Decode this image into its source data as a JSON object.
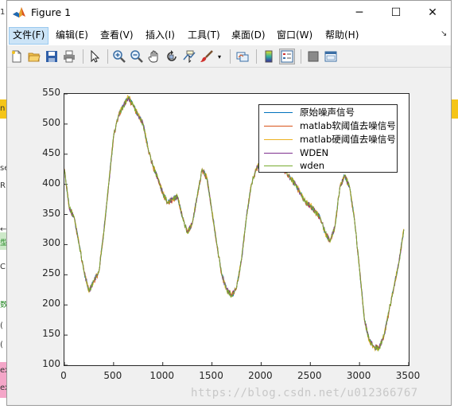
{
  "window": {
    "title": "Figure 1",
    "controls": {
      "minimize": "─",
      "maximize": "☐",
      "close": "✕"
    }
  },
  "menu": [
    {
      "label": "文件(F)",
      "active": true
    },
    {
      "label": "编辑(E)"
    },
    {
      "label": "查看(V)"
    },
    {
      "label": "插入(I)"
    },
    {
      "label": "工具(T)"
    },
    {
      "label": "桌面(D)"
    },
    {
      "label": "窗口(W)"
    },
    {
      "label": "帮助(H)"
    }
  ],
  "menu_overflow": "↘",
  "toolbar": [
    "new-figure-icon",
    "open-file-icon",
    "save-icon",
    "print-icon",
    "pointer-icon",
    "zoom-in-icon",
    "zoom-out-icon",
    "pan-icon",
    "rotate-icon",
    "data-cursor-icon",
    "brush-icon",
    "link-plot-icon",
    "colorbar-icon",
    "legend-icon",
    "hide-plot-tools-icon",
    "show-plot-tools-icon"
  ],
  "background_fragments": [
    "1",
    "n",
    "se",
    "R",
    "←",
    "型",
    "C",
    "数",
    "(",
    "(",
    "ex",
    "ex"
  ],
  "chart_data": {
    "type": "line",
    "xlim": [
      0,
      3500
    ],
    "ylim": [
      100,
      550
    ],
    "xticks": [
      0,
      500,
      1000,
      1500,
      2000,
      2500,
      3000,
      3500
    ],
    "yticks": [
      100,
      150,
      200,
      250,
      300,
      350,
      400,
      450,
      500,
      550
    ],
    "xtick_labels": [
      "0",
      "500",
      "1000",
      "1500",
      "2000",
      "2500",
      "3000",
      "3500"
    ],
    "ytick_labels": [
      "100",
      "150",
      "200",
      "250",
      "300",
      "350",
      "400",
      "450",
      "500",
      "550"
    ],
    "grid": false,
    "legend_position": "top-right",
    "x": [
      0,
      50,
      100,
      150,
      200,
      250,
      300,
      350,
      400,
      450,
      500,
      550,
      600,
      650,
      700,
      750,
      800,
      850,
      900,
      950,
      1000,
      1050,
      1100,
      1150,
      1200,
      1250,
      1300,
      1350,
      1400,
      1450,
      1500,
      1550,
      1600,
      1650,
      1700,
      1750,
      1800,
      1850,
      1900,
      1950,
      2000,
      2050,
      2100,
      2150,
      2200,
      2250,
      2300,
      2350,
      2400,
      2450,
      2500,
      2550,
      2600,
      2650,
      2700,
      2750,
      2800,
      2850,
      2900,
      2950,
      3000,
      3050,
      3100,
      3150,
      3200,
      3250,
      3300,
      3350,
      3400,
      3450
    ],
    "series": [
      {
        "name": "原始噪声信号",
        "color": "#0072bd",
        "values": [
          425,
          360,
          345,
          300,
          255,
          222,
          240,
          255,
          320,
          400,
          480,
          515,
          530,
          545,
          530,
          515,
          500,
          460,
          430,
          410,
          385,
          370,
          375,
          380,
          345,
          320,
          335,
          380,
          425,
          410,
          355,
          300,
          250,
          225,
          215,
          228,
          275,
          345,
          400,
          425,
          440,
          450,
          445,
          435,
          430,
          420,
          410,
          400,
          385,
          370,
          365,
          355,
          345,
          320,
          305,
          330,
          395,
          415,
          395,
          340,
          260,
          175,
          140,
          130,
          128,
          150,
          190,
          230,
          270,
          325
        ]
      },
      {
        "name": "matlab软阈值去噪信号",
        "color": "#d95319",
        "values": [
          424,
          359,
          344,
          299,
          254,
          223,
          239,
          254,
          319,
          399,
          479,
          514,
          529,
          543,
          529,
          514,
          499,
          459,
          429,
          409,
          384,
          369,
          374,
          379,
          344,
          321,
          334,
          379,
          424,
          409,
          354,
          299,
          249,
          226,
          216,
          227,
          274,
          344,
          399,
          424,
          439,
          449,
          444,
          434,
          429,
          419,
          409,
          399,
          384,
          369,
          364,
          354,
          344,
          321,
          306,
          329,
          394,
          414,
          394,
          339,
          259,
          176,
          141,
          131,
          129,
          149,
          189,
          229,
          269,
          324
        ]
      },
      {
        "name": "matlab硬阈值去噪信号",
        "color": "#edb120",
        "values": [
          426,
          361,
          346,
          301,
          256,
          221,
          241,
          256,
          321,
          401,
          481,
          516,
          531,
          546,
          531,
          516,
          501,
          461,
          431,
          411,
          386,
          371,
          376,
          381,
          346,
          319,
          336,
          381,
          426,
          411,
          356,
          301,
          251,
          224,
          214,
          229,
          276,
          346,
          401,
          426,
          441,
          451,
          446,
          436,
          431,
          421,
          411,
          401,
          386,
          371,
          366,
          356,
          346,
          319,
          304,
          331,
          396,
          416,
          396,
          341,
          261,
          174,
          139,
          129,
          127,
          151,
          191,
          231,
          271,
          326
        ]
      },
      {
        "name": "WDEN",
        "color": "#7e2f8e",
        "values": [
          425,
          360,
          345,
          300,
          255,
          223,
          240,
          255,
          320,
          400,
          480,
          515,
          530,
          544,
          530,
          515,
          500,
          460,
          430,
          410,
          385,
          370,
          375,
          380,
          345,
          321,
          335,
          380,
          425,
          410,
          355,
          300,
          250,
          226,
          216,
          228,
          275,
          345,
          400,
          425,
          440,
          450,
          445,
          435,
          430,
          420,
          410,
          400,
          385,
          370,
          365,
          355,
          345,
          321,
          306,
          330,
          395,
          415,
          395,
          340,
          260,
          176,
          141,
          131,
          129,
          150,
          190,
          230,
          270,
          325
        ]
      },
      {
        "name": "wden",
        "color": "#77ac30",
        "values": [
          424,
          361,
          345,
          300,
          255,
          222,
          240,
          255,
          320,
          400,
          480,
          515,
          530,
          545,
          530,
          515,
          500,
          460,
          430,
          410,
          385,
          370,
          375,
          380,
          345,
          320,
          335,
          380,
          425,
          410,
          355,
          300,
          250,
          225,
          215,
          228,
          275,
          345,
          400,
          425,
          440,
          450,
          445,
          435,
          430,
          420,
          410,
          400,
          385,
          370,
          365,
          355,
          345,
          320,
          305,
          330,
          395,
          415,
          395,
          340,
          260,
          175,
          140,
          130,
          128,
          150,
          190,
          230,
          270,
          325
        ]
      }
    ]
  },
  "watermark": "https://blog.csdn.net/u012366767"
}
